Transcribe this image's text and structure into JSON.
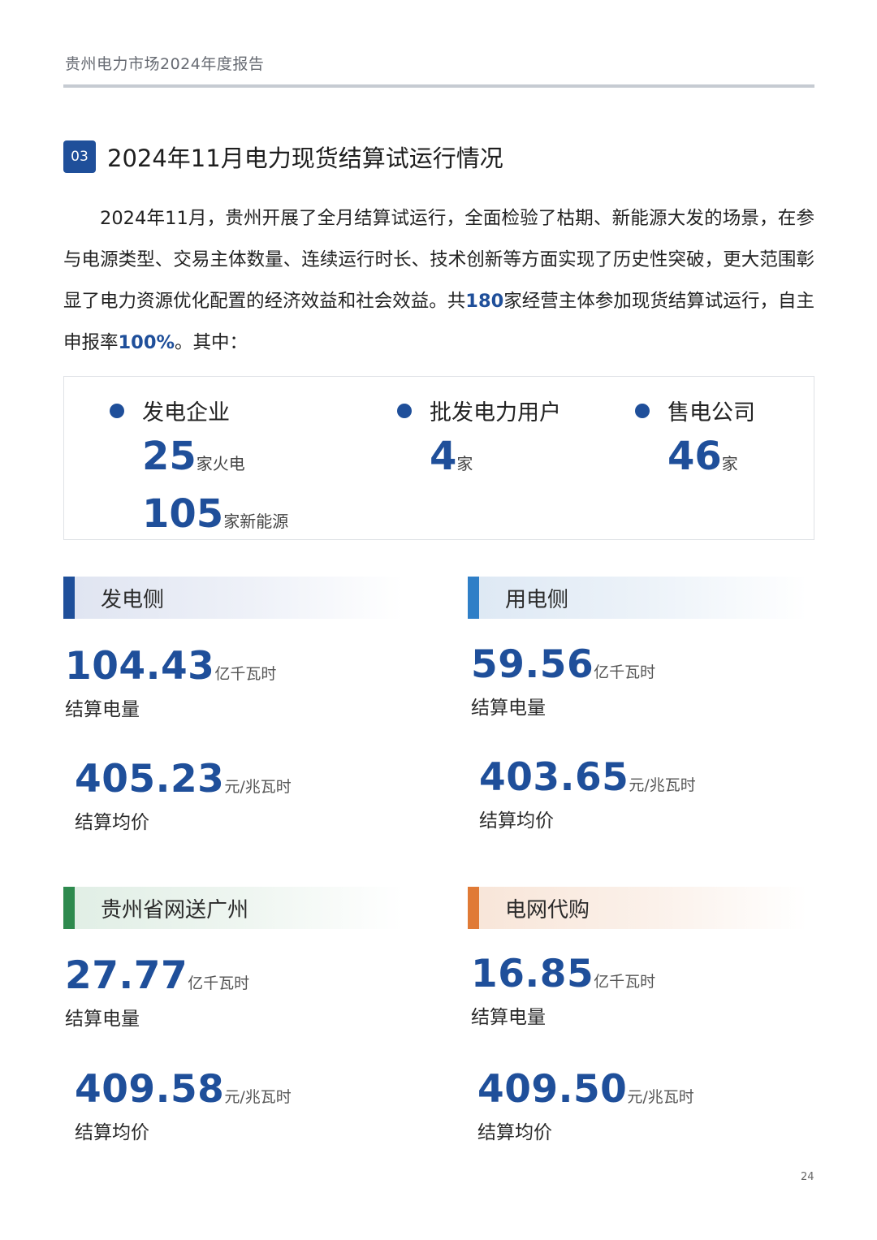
{
  "header": {
    "title": "贵州电力市场2024年度报告"
  },
  "section": {
    "number": "03",
    "title": "2024年11月电力现货结算试运行情况"
  },
  "intro": {
    "text_a": "2024年11月，贵州开展了全月结算试运行，全面检验了枯期、新能源大发的场景，在参与电源类型、交易主体数量、连续运行时长、技术创新等方面实现了历史性突破，更大范围彰显了电力资源优化配置的经济效益和社会效益。共",
    "highlight_a": "180",
    "text_b": "家经营主体参加现货结算试运行，自主申报率",
    "highlight_b": "100%",
    "text_c": "。其中："
  },
  "stats": {
    "gen": {
      "title": "发电企业",
      "thermal_num": "25",
      "thermal_unit": "家火电",
      "renew_num": "105",
      "renew_unit": "家新能源"
    },
    "wholesale": {
      "title": "批发电力用户",
      "num": "4",
      "unit": "家"
    },
    "retail": {
      "title": "售电公司",
      "num": "46",
      "unit": "家"
    }
  },
  "categories": {
    "gen_side": {
      "title": "发电侧",
      "color": "#1f4f9a",
      "energy": {
        "value": "104.43",
        "unit": "亿千瓦时",
        "label": "结算电量"
      },
      "price": {
        "value": "405.23",
        "unit": "元/兆瓦时",
        "label": "结算均价"
      }
    },
    "use_side": {
      "title": "用电侧",
      "color": "#2f7fc7",
      "energy": {
        "value": "59.56",
        "unit": "亿千瓦时",
        "label": "结算电量"
      },
      "price": {
        "value": "403.65",
        "unit": "元/兆瓦时",
        "label": "结算均价"
      }
    },
    "guangzhou": {
      "title": "贵州省网送广州",
      "color": "#2e8a4e",
      "energy": {
        "value": "27.77",
        "unit": "亿千瓦时",
        "label": "结算电量"
      },
      "price": {
        "value": "409.58",
        "unit": "元/兆瓦时",
        "label": "结算均价"
      }
    },
    "grid_purchase": {
      "title": "电网代购",
      "color": "#e07a36",
      "energy": {
        "value": "16.85",
        "unit": "亿千瓦时",
        "label": "结算电量"
      },
      "price": {
        "value": "409.50",
        "unit": "元/兆瓦时",
        "label": "结算均价"
      }
    }
  },
  "page_number": "24"
}
